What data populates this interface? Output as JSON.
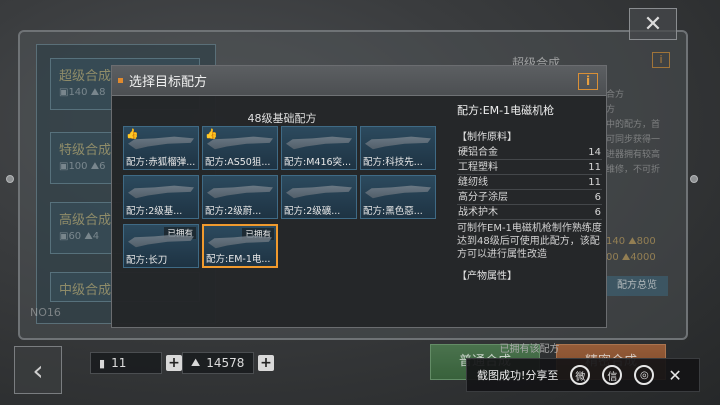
{
  "background": {
    "tabs": [
      {
        "title": "超级合成",
        "stats": "▣140 ⛰8"
      },
      {
        "title": "特级合成",
        "stats": "▣100 ⛰6"
      },
      {
        "title": "高级合成",
        "stats": "▣60 ⛰4"
      },
      {
        "title": "中级合成",
        "stats": ""
      }
    ],
    "nameplate": "NO16",
    "right_title": "超级合成",
    "right_info": "i",
    "right_lines": [
      "合方",
      "方",
      "中的配方，首",
      "可同步获得一",
      "进器拥有较高",
      "维修，不可折"
    ],
    "right_res": [
      "140 ⛰800",
      "00 ⛰4000"
    ],
    "right_button": "配方总览",
    "green_button": "普通合成",
    "orange_button": "精密合成"
  },
  "resources": {
    "parts": "11",
    "material": "14578"
  },
  "modal": {
    "title": "选择目标配方",
    "info_label": "i",
    "grid_title": "48级基础配方",
    "recipes": [
      {
        "label": "配方:赤狐榴弹...",
        "owned": "",
        "thumb": true
      },
      {
        "label": "配方:AS50狙...",
        "owned": "",
        "thumb": true
      },
      {
        "label": "配方:M416突...",
        "owned": "",
        "thumb": false
      },
      {
        "label": "配方:科技先...",
        "owned": "",
        "thumb": false
      },
      {
        "label": "配方:2级基...",
        "owned": "",
        "thumb": false
      },
      {
        "label": "配方:2级蔚...",
        "owned": "",
        "thumb": false
      },
      {
        "label": "配方:2级礦...",
        "owned": "",
        "thumb": false
      },
      {
        "label": "配方:黑色惡...",
        "owned": "",
        "thumb": false
      },
      {
        "label": "配方:长刀",
        "owned": "已拥有",
        "thumb": false
      },
      {
        "label": "配方:EM-1电...",
        "owned": "已拥有",
        "thumb": false,
        "selected": true
      }
    ],
    "detail": {
      "title": "配方:EM-1电磁机枪",
      "materials_header": "【制作原料】",
      "materials": [
        {
          "name": "硬铝合金",
          "qty": "14"
        },
        {
          "name": "工程塑料",
          "qty": "11"
        },
        {
          "name": "缝纫线",
          "qty": "11"
        },
        {
          "name": "高分子涂层",
          "qty": "6"
        },
        {
          "name": "战术护木",
          "qty": "6"
        }
      ],
      "description": "可制作EM-1电磁机枪制作熟练度达到48级后可使用此配方，该配方可以进行属性改造",
      "product_header": "【产物属性】",
      "owned_text": "已拥有该配方"
    }
  },
  "share": {
    "text": "截图成功!分享至",
    "icons": [
      "weibo-icon",
      "wechat-icon",
      "moments-icon"
    ]
  }
}
